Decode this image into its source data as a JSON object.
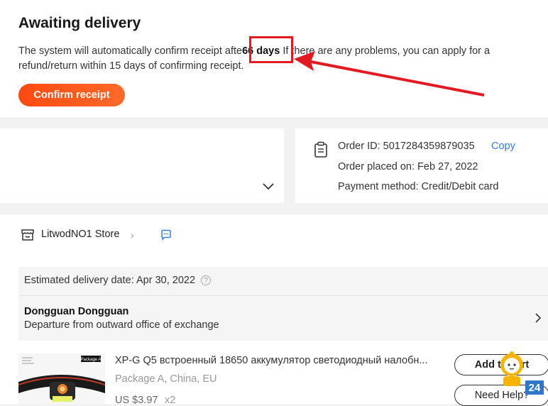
{
  "status": {
    "title": "Awaiting delivery",
    "notice_before": "The system will automatically confirm receipt afte",
    "notice_days": "66 days",
    "notice_after": " If there are any problems, you can apply for a refund/return within 15 days of confirming receipt.",
    "confirm_label": "Confirm receipt"
  },
  "order": {
    "id_line": "Order ID: 5017284359879035",
    "copy_label": "Copy",
    "placed_line": "Order placed on: Feb 27, 2022",
    "payment_line": "Payment method: Credit/Debit card"
  },
  "store": {
    "name": "LitwodNO1 Store"
  },
  "delivery": {
    "estimated": "Estimated delivery date: Apr 30, 2022",
    "location": "Dongguan Dongguan",
    "event": "Departure from outward office of exchange"
  },
  "product": {
    "title": "XP-G Q5 встроенный 18650 аккумулятор светодиодный налобн...",
    "variant": "Package A, China, EU",
    "price": "US $3.97",
    "qty": "x2",
    "image_label": "Package A",
    "add_cart_label": "Add to cart",
    "need_help_label": "Need Help?"
  },
  "widget": {
    "badge": "24"
  },
  "colors": {
    "accent": "#ff4a11",
    "link": "#3a7bd5",
    "annotation": "#e21a23"
  }
}
